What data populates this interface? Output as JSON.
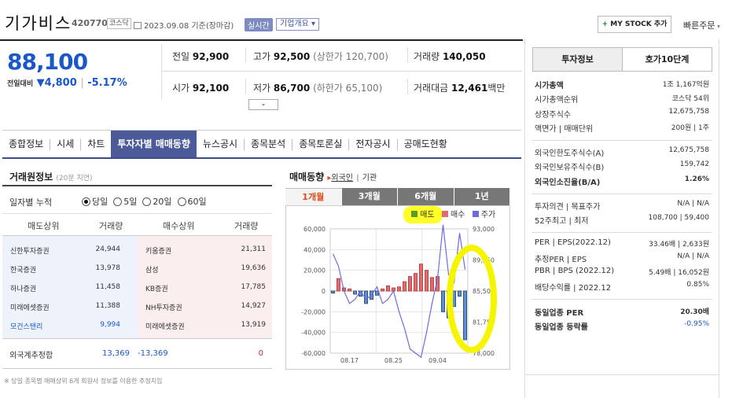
{
  "header": {
    "name": "기가비스",
    "code": "420770",
    "market_badge": "코스닥",
    "date": "2023.09.08 기준(장마감)",
    "live": "실시간",
    "corp_info": "기업개요 ▾",
    "mystock": "MY STOCK 추가",
    "quick_order": "빠른주문"
  },
  "price": {
    "current": "88,100",
    "change_label": "전일대비",
    "change_value": "▼4,800",
    "change_pct": "-5.17%"
  },
  "stats": {
    "prev_label": "전일",
    "prev": "92,900",
    "high_label": "고가",
    "high": "92,500",
    "high_note": "(상한가 120,700)",
    "vol_label": "거래량",
    "vol": "140,050",
    "open_label": "시가",
    "open": "92,100",
    "low_label": "저가",
    "low": "86,700",
    "low_note": "(하한가 65,100)",
    "amt_label": "거래대금",
    "amt": "12,461",
    "amt_unit": "백만"
  },
  "tabs": [
    "종합정보",
    "시세",
    "차트",
    "투자자별 매매동향",
    "뉴스공시",
    "종목분석",
    "종목토론실",
    "전자공시",
    "공매도현황"
  ],
  "trade": {
    "title": "거래원정보",
    "sub": "(20분 지연)",
    "period_label": "일자별 누적",
    "radios": [
      "당일",
      "5일",
      "20일",
      "60일"
    ],
    "headers": [
      "매도상위",
      "거래량",
      "매수상위",
      "거래량"
    ],
    "rows": [
      [
        "신한투자증권",
        "24,944",
        "키움증권",
        "21,311"
      ],
      [
        "한국증권",
        "13,978",
        "삼성",
        "19,636"
      ],
      [
        "하나증권",
        "11,458",
        "KB증권",
        "17,785"
      ],
      [
        "미래에셋증권",
        "11,388",
        "NH투자증권",
        "14,927"
      ],
      [
        "모건스탠리",
        "9,994",
        "미래에셋증권",
        "13,919"
      ]
    ],
    "foreign_label": "외국계추정합",
    "foreign_sell": "13,369",
    "foreign_net": "-13,369",
    "foreign_buy": "0",
    "note": "※ 당일 종목별 매매상위 6개 회원사 정보를 이용한 추정치임"
  },
  "flow": {
    "title": "매매동향",
    "tab_foreign": "외국인",
    "tab_inst": "기관"
  },
  "chart_tabs": [
    "1개월",
    "3개월",
    "6개월",
    "1년"
  ],
  "chart_data": {
    "type": "bar",
    "legend": [
      "매도",
      "매수",
      "주가"
    ],
    "y_left": [
      "60,000",
      "40,000",
      "20,000",
      "0",
      "-20,000",
      "-40,000",
      "-60,000"
    ],
    "y_right": [
      "93,000",
      "89,250",
      "85,500",
      "81,750",
      "78,000"
    ],
    "x_ticks": [
      "08.17",
      "08.25",
      "09.04"
    ],
    "bars": [
      -2000,
      12000,
      3000,
      2000,
      -3000,
      -5000,
      -12000,
      -8000,
      -4000,
      2000,
      5000,
      3000,
      4000,
      9000,
      14000,
      17000,
      26000,
      20000,
      13000,
      14000,
      -20000,
      -26000,
      -15000,
      -5000,
      -47000
    ],
    "price": [
      90000,
      88500,
      85500,
      84000,
      84500,
      85500,
      84500,
      85000,
      86000,
      84000,
      84500,
      85500,
      83000,
      81000,
      78500,
      78000,
      77500,
      80500,
      84000,
      87000,
      93500,
      87500,
      86500,
      92500,
      88100
    ],
    "colors": {
      "sell": "#5b8fd6",
      "buy": "#e36a6f",
      "price": "#6c6ce0"
    }
  },
  "info": {
    "tab1": "투자정보",
    "tab2": "호가10단계",
    "rows": [
      [
        "시가총액",
        "1조 1,167억원"
      ],
      [
        "시가총액순위",
        "코스닥 54위"
      ],
      [
        "상장주식수",
        "12,675,758"
      ],
      [
        "액면가 | 매매단위",
        "200원 | 1주"
      ],
      [
        "외국인한도주식수(A)",
        "12,675,758"
      ],
      [
        "외국인보유주식수(B)",
        "159,742"
      ],
      [
        "외국인소진율(B/A)",
        "1.26%"
      ],
      [
        "투자의견 | 목표주가",
        "N/A | N/A"
      ],
      [
        "52주최고 | 최저",
        "108,700 | 59,400"
      ],
      [
        "PER | EPS(2022.12)",
        "33.46배 | 2,633원"
      ],
      [
        "추정PER | EPS",
        "N/A | N/A"
      ],
      [
        "PBR | BPS (2022.12)",
        "5.49배 | 16,052원"
      ],
      [
        "배당수익률 | 2022.12",
        "0.85%"
      ],
      [
        "동일업종 PER",
        "20.30배"
      ],
      [
        "동일업종 등락률",
        "-0.95%"
      ]
    ]
  }
}
